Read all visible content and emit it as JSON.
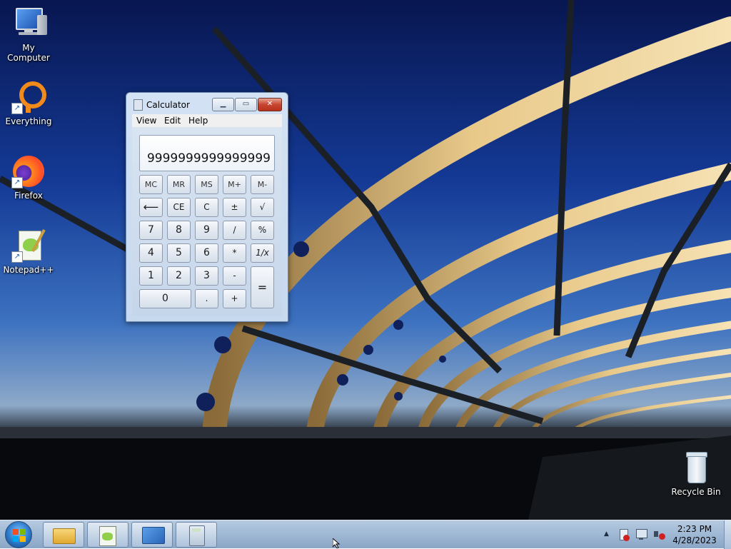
{
  "desktop": {
    "icons": [
      {
        "label": "My Computer",
        "icon": "computer-icon"
      },
      {
        "label": "Everything",
        "icon": "everything-icon"
      },
      {
        "label": "Firefox",
        "icon": "firefox-icon"
      },
      {
        "label": "Notepad++",
        "icon": "notepadpp-icon"
      },
      {
        "label": "Recycle Bin",
        "icon": "recycle-bin-icon"
      }
    ]
  },
  "calculator": {
    "title": "Calculator",
    "window_buttons": {
      "minimize": "▁",
      "maximize": "▭",
      "close": "✕"
    },
    "menu": [
      "View",
      "Edit",
      "Help"
    ],
    "display": "9999999999999999",
    "keys": {
      "mc": "MC",
      "mr": "MR",
      "ms": "MS",
      "mplus": "M+",
      "mminus": "M-",
      "backspace": "⟵",
      "ce": "CE",
      "c": "C",
      "plusminus": "±",
      "sqrt": "√",
      "k7": "7",
      "k8": "8",
      "k9": "9",
      "div": "/",
      "pct": "%",
      "k4": "4",
      "k5": "5",
      "k6": "6",
      "mul": "*",
      "recip": "1/x",
      "k1": "1",
      "k2": "2",
      "k3": "3",
      "sub": "-",
      "eq": "=",
      "k0": "0",
      "dot": ".",
      "add": "+"
    }
  },
  "taskbar": {
    "pinned": [
      "file-explorer-icon",
      "notepadpp-icon",
      "control-panel-icon",
      "calculator-icon"
    ],
    "tray_icons": [
      "show-hidden-icons",
      "action-center-flag-icon",
      "network-icon",
      "volume-muted-icon"
    ],
    "tray_chevron": "▲",
    "clock": {
      "time": "2:23 PM",
      "date": "4/28/2023"
    }
  },
  "colors": {
    "taskbar": "#9fb8d4",
    "close_button": "#c64630",
    "window_frame": "#c7d9ef"
  }
}
